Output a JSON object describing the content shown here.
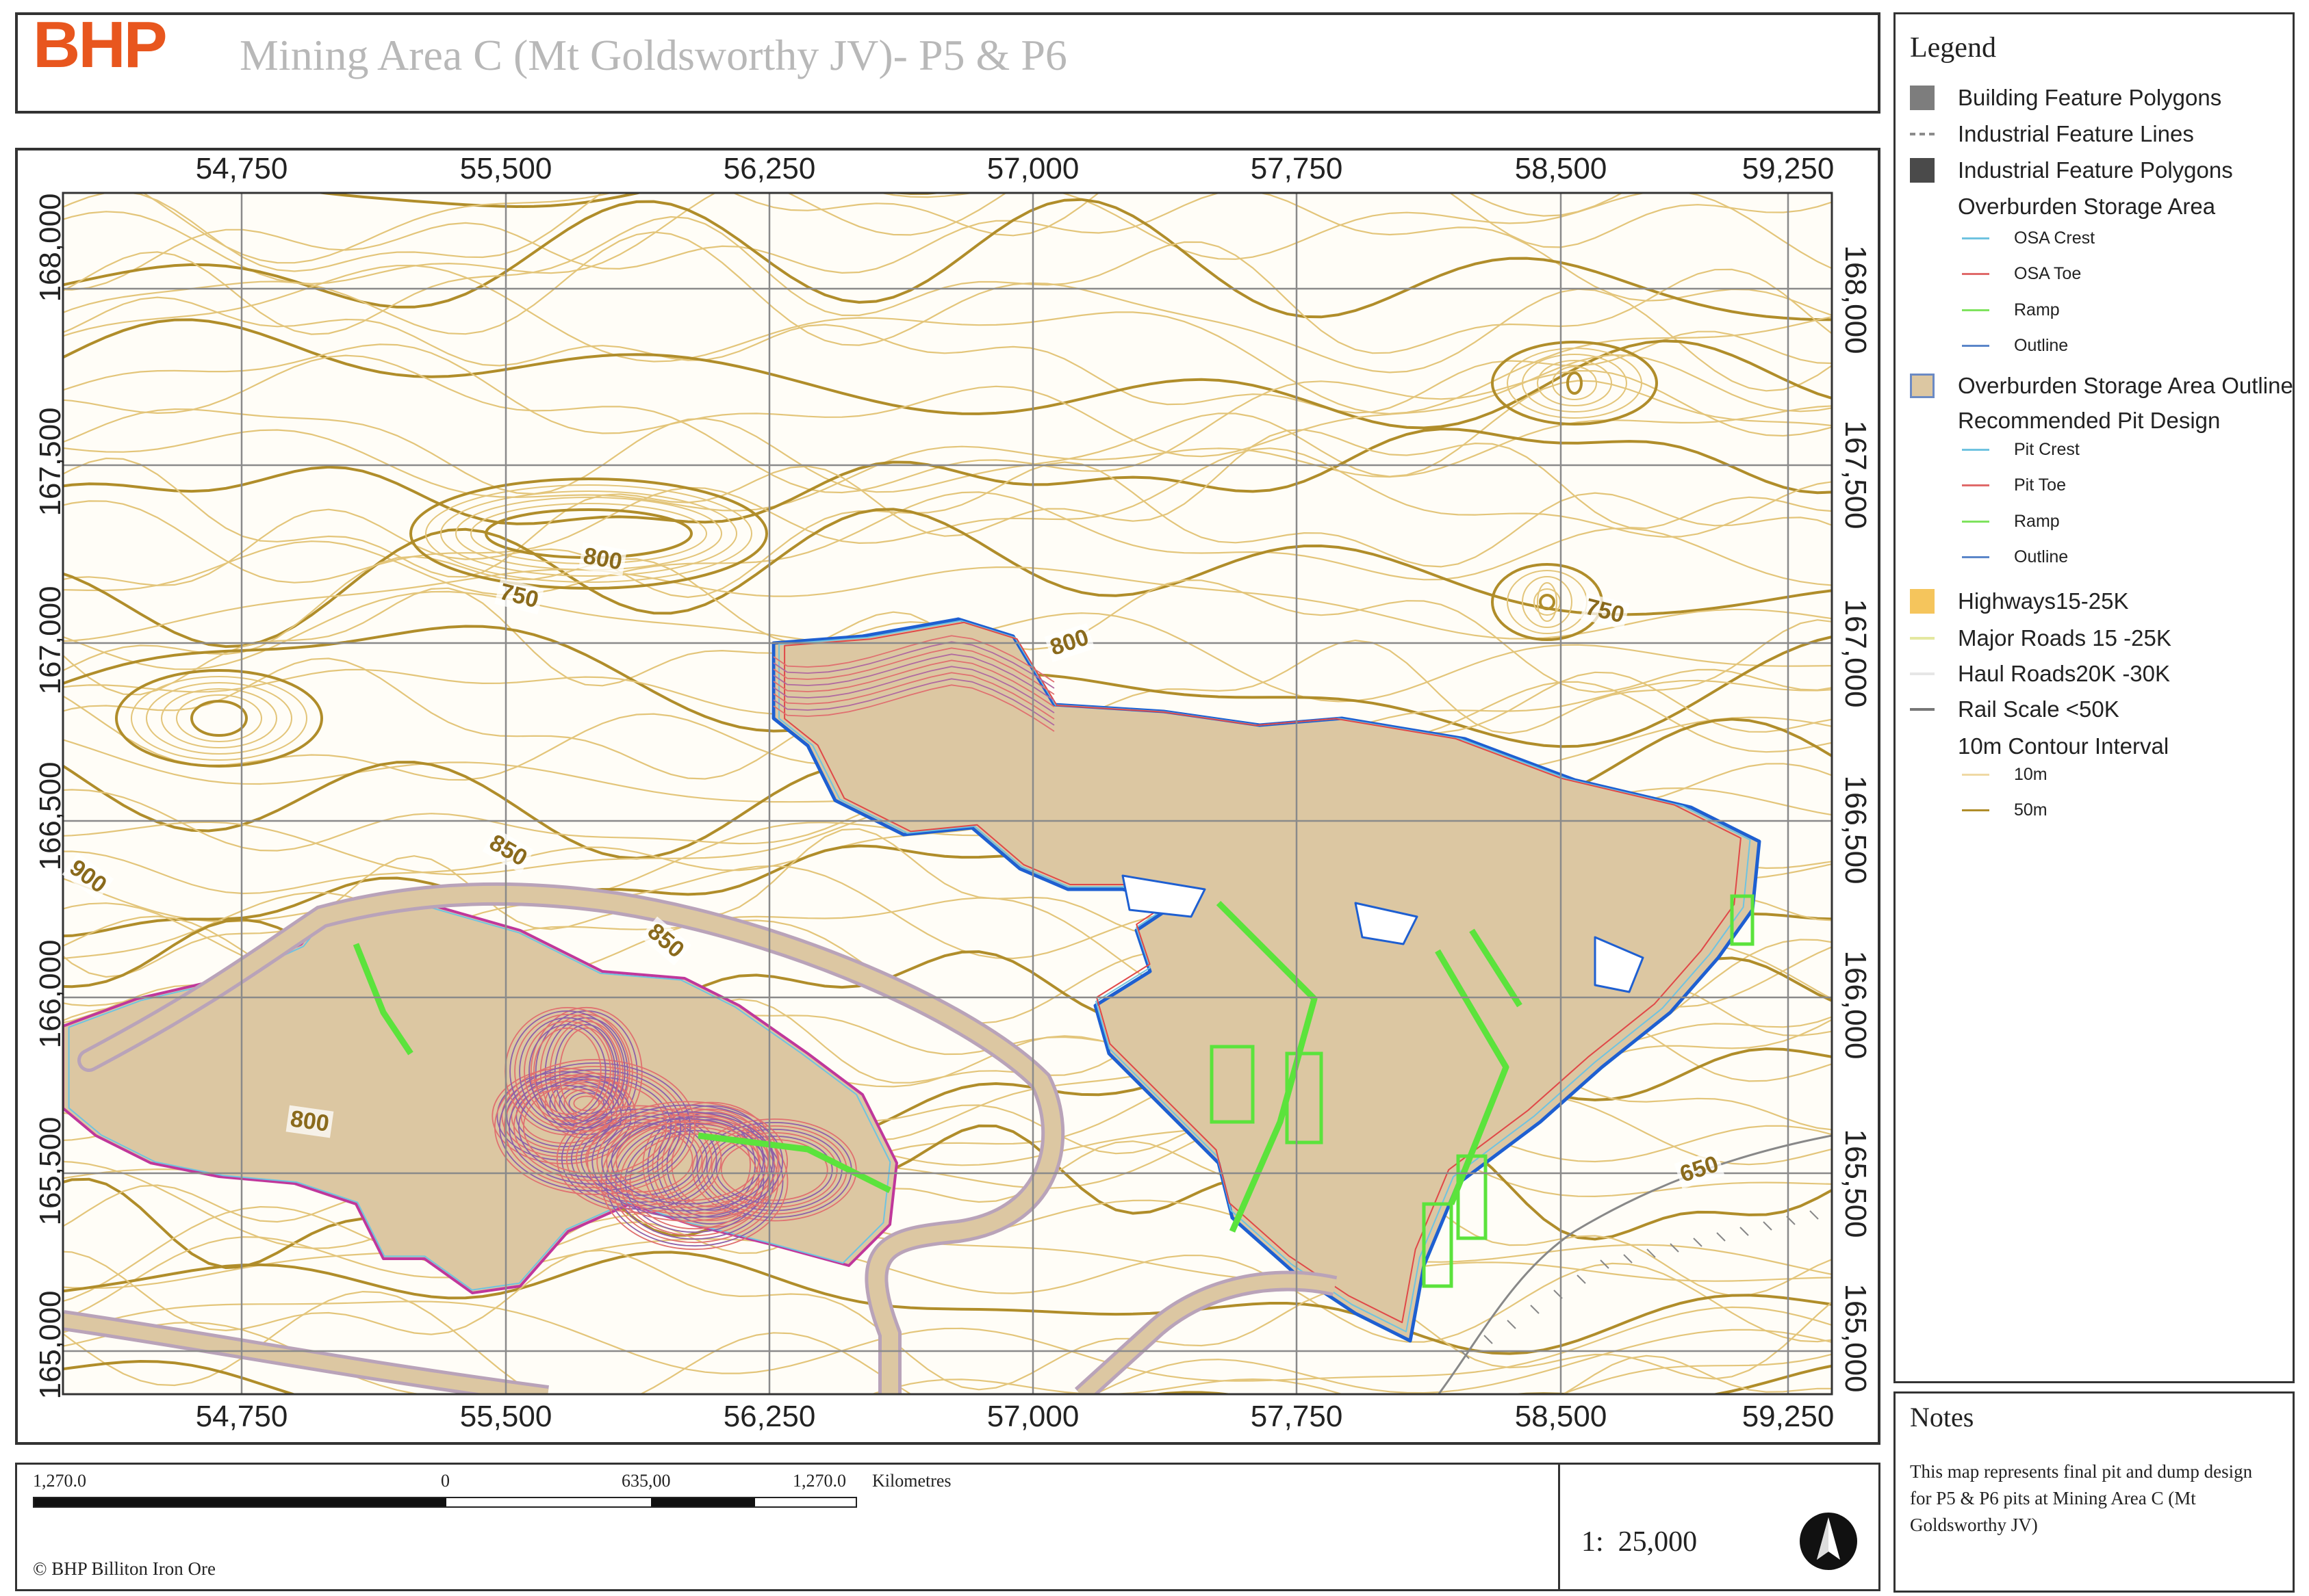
{
  "header": {
    "logo": "BHP",
    "title": "Mining Area C (Mt Goldsworthy JV)- P5 & P6"
  },
  "map": {
    "x_ticks": [
      "54,750",
      "55,500",
      "56,250",
      "57,000",
      "57,750",
      "58,500",
      "59,250"
    ],
    "y_ticks": [
      "168,000",
      "167,500",
      "167,000",
      "166,500",
      "166,000",
      "165,500",
      "165,000"
    ],
    "contour_labels": [
      "800",
      "750",
      "800",
      "750",
      "850",
      "900",
      "850",
      "800",
      "650"
    ],
    "colors": {
      "contour_10m": "#e3c57a",
      "contour_50m": "#b08d2a",
      "pit_fill": "#dcc7a2",
      "pit_outline": "#1e5fd1",
      "pit_crest": "#6fc3e0",
      "pit_toe": "#e04848",
      "ramp": "#5be33c",
      "osa_toe": "#c0379b",
      "grid": "#8a8a8a",
      "rail": "#888888"
    }
  },
  "legend": {
    "title": "Legend",
    "items": [
      {
        "label": "Building Feature Polygons",
        "kind": "box",
        "color": "#7d7d7d"
      },
      {
        "label": "Industrial Feature Lines",
        "kind": "dash",
        "color": "#8c8c8c"
      },
      {
        "label": "Industrial Feature Polygons",
        "kind": "box",
        "color": "#4a4a4a"
      },
      {
        "label": "Overburden Storage Area",
        "kind": "head"
      },
      {
        "label": "OSA Crest",
        "kind": "sub",
        "color": "#6fc3e0"
      },
      {
        "label": "OSA Toe",
        "kind": "sub",
        "color": "#e06a6a"
      },
      {
        "label": "Ramp",
        "kind": "sub",
        "color": "#7fe35e"
      },
      {
        "label": "Outline",
        "kind": "sub",
        "color": "#5b86c9"
      },
      {
        "label": "Overburden Storage Area Outline",
        "kind": "box",
        "color": "#dcc7a2"
      },
      {
        "label": "Recommended Pit Design",
        "kind": "head"
      },
      {
        "label": "Pit Crest",
        "kind": "sub",
        "color": "#6fc3e0"
      },
      {
        "label": "Pit Toe",
        "kind": "sub",
        "color": "#e06a6a"
      },
      {
        "label": "Ramp",
        "kind": "sub",
        "color": "#7fe35e"
      },
      {
        "label": "Outline",
        "kind": "sub",
        "color": "#5b86c9"
      },
      {
        "label": "Highways15-25K",
        "kind": "box",
        "color": "#f5c55c"
      },
      {
        "label": "Major Roads 15    -25K",
        "kind": "line",
        "color": "#e4e8a0"
      },
      {
        "label": "Haul Roads20K    -30K",
        "kind": "line",
        "color": "#e6e6e6"
      },
      {
        "label": "Rail Scale <50K",
        "kind": "rail",
        "color": "#777777"
      },
      {
        "label": "10m Contour Interval",
        "kind": "head"
      },
      {
        "label": "10m",
        "kind": "sub",
        "color": "#efd9a4"
      },
      {
        "label": "50m",
        "kind": "sub",
        "color": "#b08d2a"
      }
    ]
  },
  "notes": {
    "title": "Notes",
    "text": "This map represents final pit and dump design for P5 & P6 pits at Mining Area C (Mt Goldsworthy JV)"
  },
  "scale": {
    "labels": [
      "1,270.0",
      "0",
      "635,00",
      "1,270.0",
      "Kilometres"
    ],
    "ratio_prefix": "1:",
    "ratio_value": "25,000",
    "copyright": "© BHP Billiton Iron Ore"
  }
}
